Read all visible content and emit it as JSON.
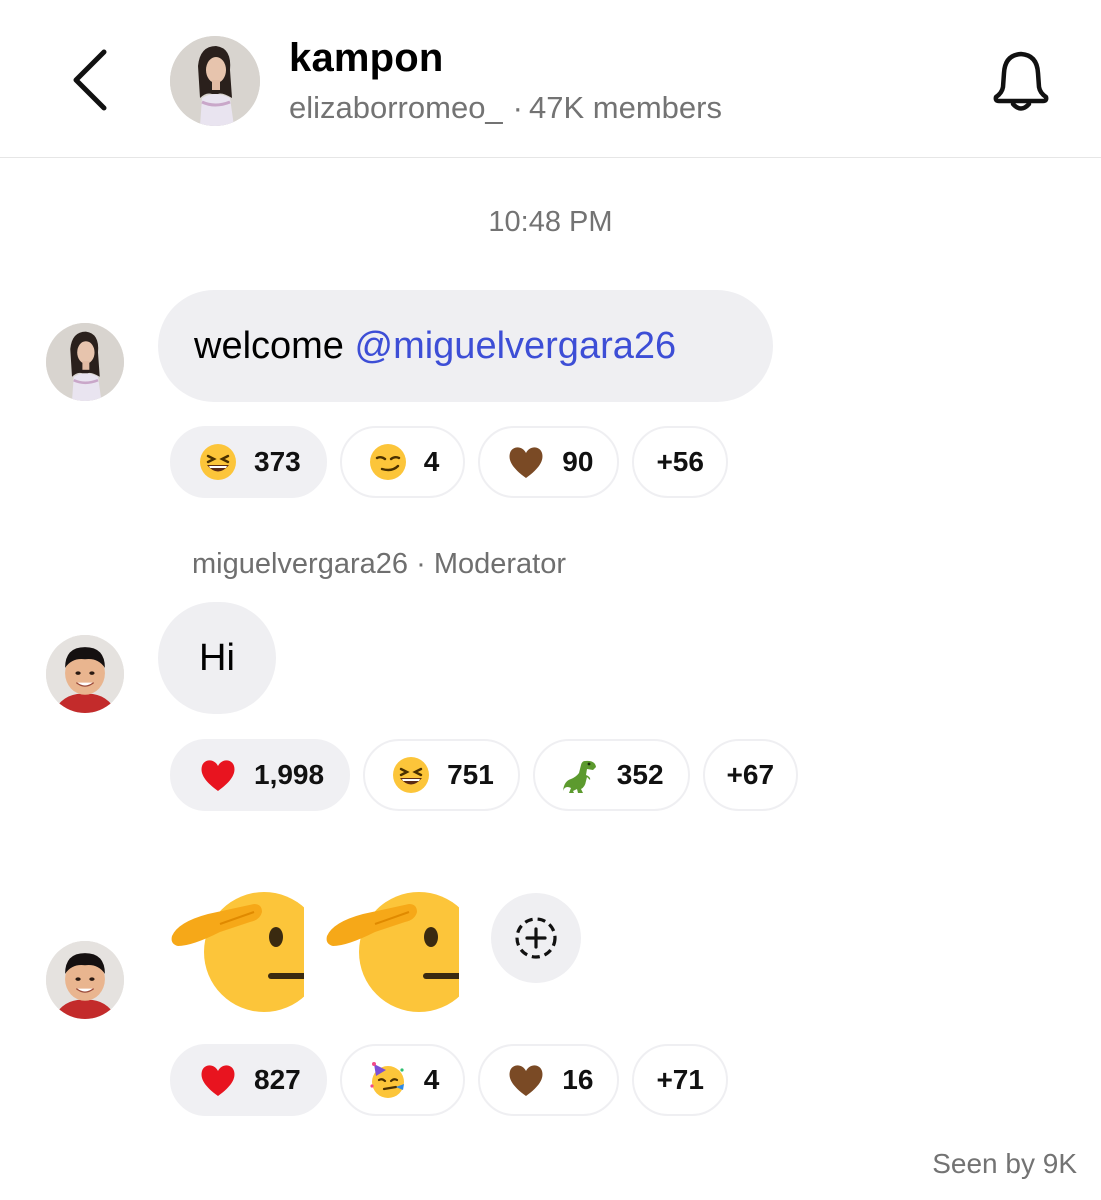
{
  "header": {
    "title": "kampon",
    "owner": "elizaborromeo_",
    "separator": "·",
    "members": "47K members"
  },
  "timestamp": "10:48 PM",
  "messages": [
    {
      "text_prefix": "welcome ",
      "mention": "@miguelvergara26",
      "reactions": [
        {
          "emoji": "grinning-squinting-face",
          "count": "373"
        },
        {
          "emoji": "smirking-face",
          "count": "4"
        },
        {
          "emoji": "brown-heart",
          "count": "90"
        },
        {
          "emoji": "more",
          "count": "+56"
        }
      ]
    },
    {
      "sender": "miguelvergara26",
      "separator": "·",
      "role": "Moderator",
      "text": "Hi",
      "reactions": [
        {
          "emoji": "red-heart",
          "count": "1,998"
        },
        {
          "emoji": "grinning-squinting-face",
          "count": "751"
        },
        {
          "emoji": "t-rex",
          "count": "352"
        },
        {
          "emoji": "more",
          "count": "+67"
        }
      ]
    },
    {
      "content": [
        "saluting-face",
        "saluting-face"
      ],
      "reactions": [
        {
          "emoji": "red-heart",
          "count": "827"
        },
        {
          "emoji": "partying-face",
          "count": "4"
        },
        {
          "emoji": "brown-heart",
          "count": "16"
        },
        {
          "emoji": "more",
          "count": "+71"
        }
      ]
    }
  ],
  "seen": "Seen by 9K",
  "colors": {
    "mention": "#3d4ed6",
    "bubble": "#efeff2",
    "muted_text": "#737373"
  }
}
